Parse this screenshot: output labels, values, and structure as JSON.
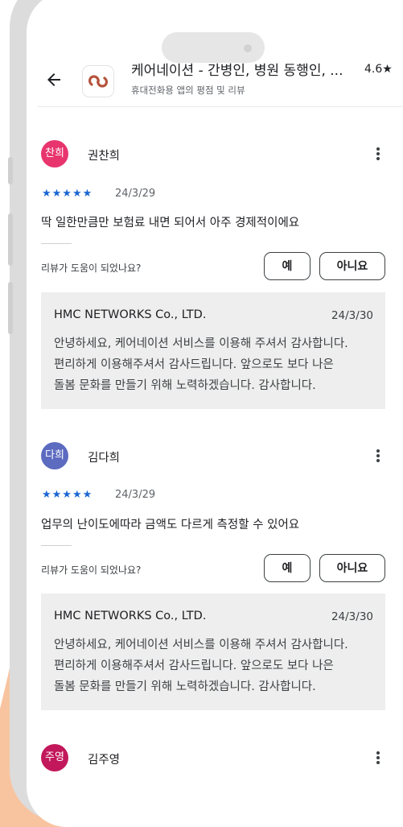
{
  "colors": {
    "background_blob": "#f8c4a0",
    "accent_blue": "#1a66d2"
  },
  "header": {
    "back_icon": "arrow-left-icon",
    "app_icon": "carenation-logo-icon",
    "app_title": "케어네이션 - 간병인, 병원 동행인, ...",
    "rating": "4.6★",
    "subtitle": "휴대전화용 앱의 평점 및 리뷰"
  },
  "reviews": [
    {
      "avatar_text": "찬희",
      "avatar_color": "#e8356e",
      "name": "권찬희",
      "stars": "★★★★★",
      "date": "24/3/29",
      "text": "딱 일한만큼만 보험료 내면 되어서 아주 경제적이에요",
      "helpful_question": "리뷰가 도움이 되었나요?",
      "yes_label": "예",
      "no_label": "아니요",
      "developer": {
        "name": "HMC NETWORKS Co., LTD.",
        "date": "24/3/30",
        "lines": [
          "안녕하세요, 케어네이션 서비스를 이용해 주셔서 감사합니다.",
          "편리하게 이용해주셔서 감사드립니다. 앞으로도 보다 나은",
          "돌봄 문화를 만들기 위해 노력하겠습니다. 감사합니다."
        ]
      }
    },
    {
      "avatar_text": "다희",
      "avatar_color": "#5c6bc0",
      "name": "김다희",
      "stars": "★★★★★",
      "date": "24/3/29",
      "text": "업무의 난이도에따라 금액도 다르게 측정할 수 있어요",
      "helpful_question": "리뷰가 도움이 되었나요?",
      "yes_label": "예",
      "no_label": "아니요",
      "developer": {
        "name": "HMC NETWORKS Co., LTD.",
        "date": "24/3/30",
        "lines": [
          "안녕하세요, 케어네이션 서비스를 이용해 주셔서 감사합니다.",
          "편리하게 이용해주셔서 감사드립니다. 앞으로도 보다 나은",
          "돌봄 문화를 만들기 위해 노력하겠습니다. 감사합니다."
        ]
      }
    },
    {
      "avatar_text": "주영",
      "avatar_color": "#c2185b",
      "name": "김주영"
    }
  ]
}
